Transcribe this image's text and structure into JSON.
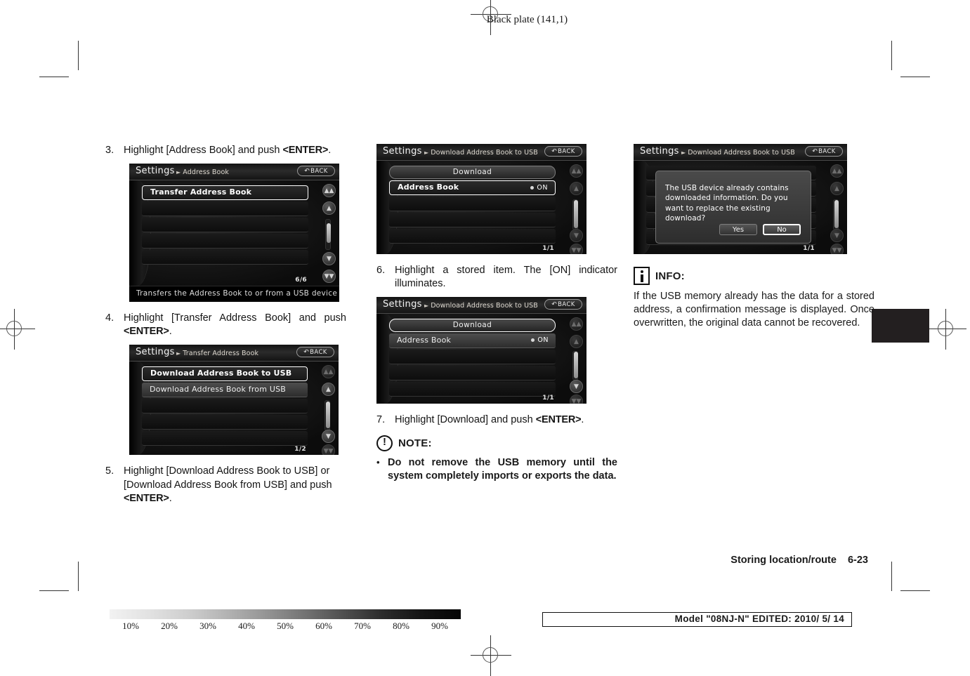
{
  "header": {
    "black_plate": "Black plate (141,1)"
  },
  "footer": {
    "section_name": "Storing location/route",
    "page_number": "6-23",
    "model_info": "Model \"08NJ-N\"  EDITED:  2010/ 5/ 14",
    "gradient_ticks": [
      "10%",
      "20%",
      "30%",
      "40%",
      "50%",
      "60%",
      "70%",
      "80%",
      "90%"
    ]
  },
  "column1": {
    "step3": {
      "num": "3.",
      "text_part1": "Highlight [Address Book] and push ",
      "kbd": "<ENTER>",
      "text_part2": "."
    },
    "screenshot1": {
      "title": "Settings",
      "breadcrumb": "Address Book",
      "back_label": "BACK",
      "rows": [
        {
          "label": "Transfer Address Book",
          "state": "selected"
        },
        {
          "label": "",
          "state": "empty"
        },
        {
          "label": "",
          "state": "empty"
        },
        {
          "label": "",
          "state": "empty"
        },
        {
          "label": "",
          "state": "empty"
        }
      ],
      "page_indicator": "6/6",
      "footer_text": "Transfers the Address Book to or from a USB device"
    },
    "step4": {
      "num": "4.",
      "text_part1": "Highlight [Transfer Address Book] and push ",
      "kbd": "<ENTER>",
      "text_part2": "."
    },
    "screenshot2": {
      "title": "Settings",
      "breadcrumb": "Transfer Address Book",
      "back_label": "BACK",
      "rows": [
        {
          "label": "Download Address Book to USB",
          "state": "selected"
        },
        {
          "label": "Download Address Book from USB",
          "state": "grey"
        },
        {
          "label": "",
          "state": "empty"
        },
        {
          "label": "",
          "state": "empty"
        },
        {
          "label": "",
          "state": "empty"
        }
      ],
      "page_indicator": "1/2"
    },
    "step5": {
      "num": "5.",
      "text_part1": "Highlight [Download Address Book to USB] or [Download Address Book from USB] and push ",
      "kbd": "<ENTER>",
      "text_part2": "."
    }
  },
  "column2": {
    "screenshot3": {
      "title": "Settings",
      "breadcrumb": "Download Address Book to USB",
      "back_label": "BACK",
      "button_label": "Download",
      "item_label": "Address Book",
      "item_indicator": "ON",
      "page_indicator": "1/1"
    },
    "step6": {
      "num": "6.",
      "text": "Highlight a stored item. The [ON] indicator illuminates."
    },
    "screenshot4": {
      "title": "Settings",
      "breadcrumb": "Download Address Book to USB",
      "back_label": "BACK",
      "button_label": "Download",
      "item_label": "Address Book",
      "item_indicator": "ON",
      "page_indicator": "1/1"
    },
    "step7": {
      "num": "7.",
      "text_part1": "Highlight [Download] and push ",
      "kbd": "<ENTER>",
      "text_part2": "."
    },
    "note": {
      "title": "NOTE:",
      "bullet": "•",
      "body": "Do not remove the USB memory until the system completely imports or exports the data."
    }
  },
  "column3": {
    "screenshot5": {
      "title": "Settings",
      "breadcrumb": "Download Address Book to USB",
      "back_label": "BACK",
      "dialog_message": "The USB device already contains downloaded information.  Do you want to replace the existing download?",
      "yes_label": "Yes",
      "no_label": "No",
      "page_indicator": "1/1"
    },
    "info": {
      "title": "INFO:",
      "body": "If the USB memory already has the data for a stored address, a confirmation message is displayed. Once overwritten, the original data cannot be recovered."
    }
  }
}
